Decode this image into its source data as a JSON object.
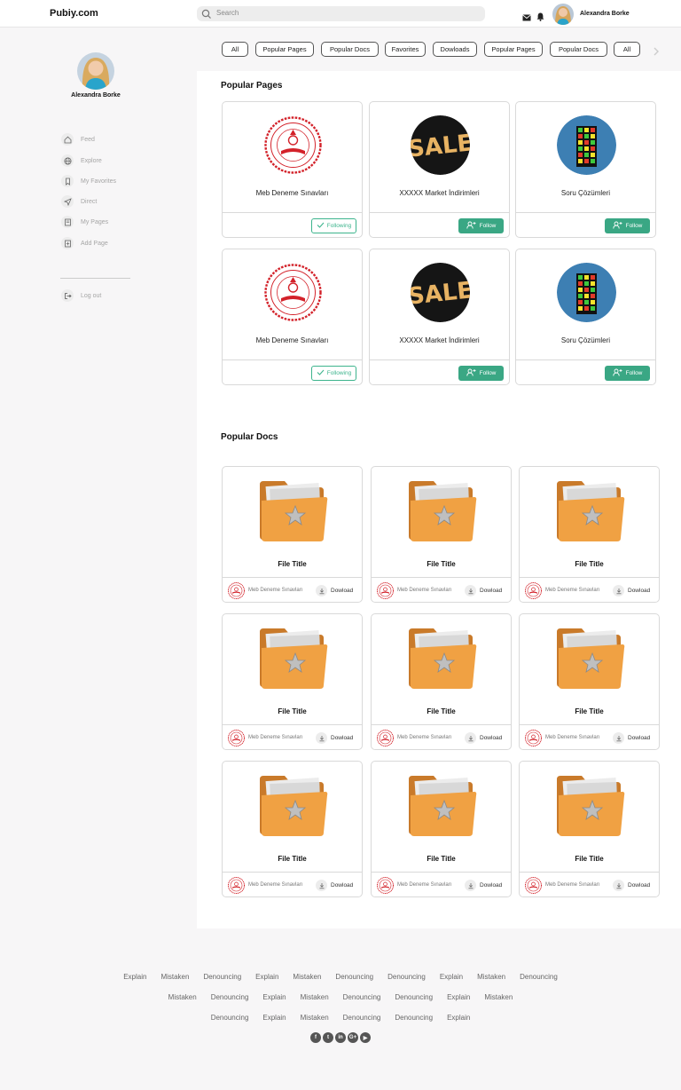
{
  "header": {
    "logo": "Pubiy.com",
    "search_placeholder": "Search",
    "user_name": "Alexandra Borke"
  },
  "sidebar": {
    "user_name": "Alexandra Borke",
    "items": [
      {
        "label": "Feed",
        "icon": "home-icon"
      },
      {
        "label": "Explore",
        "icon": "globe-icon"
      },
      {
        "label": "My Favorites",
        "icon": "bookmark-icon"
      },
      {
        "label": "Direct",
        "icon": "send-icon"
      },
      {
        "label": "My Pages",
        "icon": "pages-icon"
      },
      {
        "label": "Add Page",
        "icon": "add-page-icon"
      }
    ],
    "logout": "Log out"
  },
  "filters": [
    "All",
    "Popular Pages",
    "Popular Docs",
    "Favorites",
    "Dowloads",
    "Popular Pages",
    "Popular Docs",
    "All"
  ],
  "popular_pages": {
    "title": "Popular Pages",
    "cards": [
      {
        "name": "Meb Deneme Sınavları",
        "logo": "seal",
        "button": "Following"
      },
      {
        "name": "XXXXX Market İndirimleri",
        "logo": "sale",
        "button": "Follow"
      },
      {
        "name": "Soru Çözümleri",
        "logo": "cube",
        "button": "Follow"
      },
      {
        "name": "Meb Deneme Sınavları",
        "logo": "seal",
        "button": "Following"
      },
      {
        "name": "XXXXX Market İndirimleri",
        "logo": "sale",
        "button": "Follow"
      },
      {
        "name": "Soru Çözümleri",
        "logo": "cube",
        "button": "Follow"
      }
    ]
  },
  "popular_docs": {
    "title": "Popular Docs",
    "cards": [
      {
        "title": "File Title",
        "source": "Meb Deneme Sınavları",
        "action": "Dowload"
      },
      {
        "title": "File Title",
        "source": "Meb Deneme Sınavları",
        "action": "Dowload"
      },
      {
        "title": "File Title",
        "source": "Meb Deneme Sınavları",
        "action": "Dowload"
      },
      {
        "title": "File Title",
        "source": "Meb Deneme Sınavları",
        "action": "Dowload"
      },
      {
        "title": "File Title",
        "source": "Meb Deneme Sınavları",
        "action": "Dowload"
      },
      {
        "title": "File Title",
        "source": "Meb Deneme Sınavları",
        "action": "Dowload"
      },
      {
        "title": "File Title",
        "source": "Meb Deneme Sınavları",
        "action": "Dowload"
      },
      {
        "title": "File Title",
        "source": "Meb Deneme Sınavları",
        "action": "Dowload"
      },
      {
        "title": "File Title",
        "source": "Meb Deneme Sınavları",
        "action": "Dowload"
      }
    ]
  },
  "footer": {
    "rows": [
      [
        "Explain",
        "Mistaken",
        "Denouncing",
        "Explain",
        "Mistaken",
        "Denouncing",
        "Denouncing",
        "Explain",
        "Mistaken",
        "Denouncing"
      ],
      [
        "Mistaken",
        "Denouncing",
        "Explain",
        "Mistaken",
        "Denouncing",
        "Denouncing",
        "Explain",
        "Mistaken"
      ],
      [
        "Denouncing",
        "Explain",
        "Mistaken",
        "Denouncing",
        "Denouncing",
        "Explain"
      ]
    ],
    "social": [
      {
        "icon": "facebook-icon",
        "glyph": "f"
      },
      {
        "icon": "twitter-icon",
        "glyph": "t"
      },
      {
        "icon": "linkedin-icon",
        "glyph": "in"
      },
      {
        "icon": "google-plus-icon",
        "glyph": "G+"
      },
      {
        "icon": "youtube-icon",
        "glyph": "▶"
      }
    ]
  },
  "colors": {
    "accent_green": "#3aa784",
    "seal_red": "#d3222a",
    "folder_orange": "#f0a143"
  }
}
